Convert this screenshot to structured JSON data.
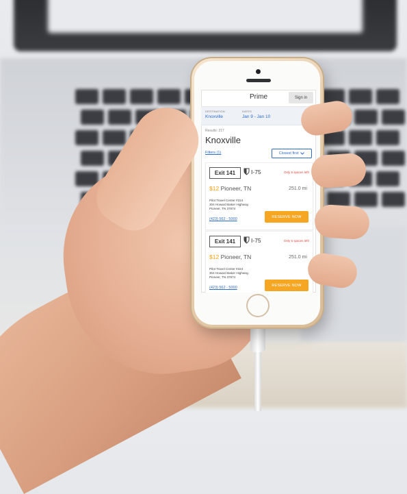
{
  "app": {
    "title": "Prime",
    "sign_in_label": "Sign in"
  },
  "search": {
    "destination_label": "DESTINATION",
    "destination_value": "Knoxville",
    "dates_label": "DATES",
    "dates_value": "Jan 9 - Jan 10",
    "icon": "search-icon"
  },
  "results": {
    "count_text": "Results: 217",
    "city_heading": "Knoxville",
    "filters_label": "Filters (1)",
    "sort_label": "Closest first",
    "sort_icon": "chevron-down-icon"
  },
  "listings": [
    {
      "exit_label": "Exit 141",
      "highway": "I-75",
      "availability": "Only 5 spaces left!",
      "price": "$12",
      "location": "Pioneer, TN",
      "distance": "251.0 mi",
      "address_line1": "Pilot Travel Center #224",
      "address_line2": "304 Howard Baker Highway,",
      "address_line3": "Pioneer, TN 37874",
      "phone": "(423) 562 - 5000",
      "reserve_label": "RESERVE NOW"
    },
    {
      "exit_label": "Exit 141",
      "highway": "I-75",
      "availability": "Only 5 spaces left!",
      "price": "$12",
      "location": "Pioneer, TN",
      "distance": "251.0 mi",
      "address_line1": "Pilot Travel Center #224",
      "address_line2": "304 Howard Baker Highway,",
      "address_line3": "Pioneer, TN 37874",
      "phone": "(423) 562 - 5000",
      "reserve_label": "RESERVE NOW"
    }
  ],
  "colors": {
    "accent_blue": "#2d6bc8",
    "price_orange": "#f2a21b",
    "reserve_orange": "#f5a623",
    "alert_red": "#e0463c"
  }
}
